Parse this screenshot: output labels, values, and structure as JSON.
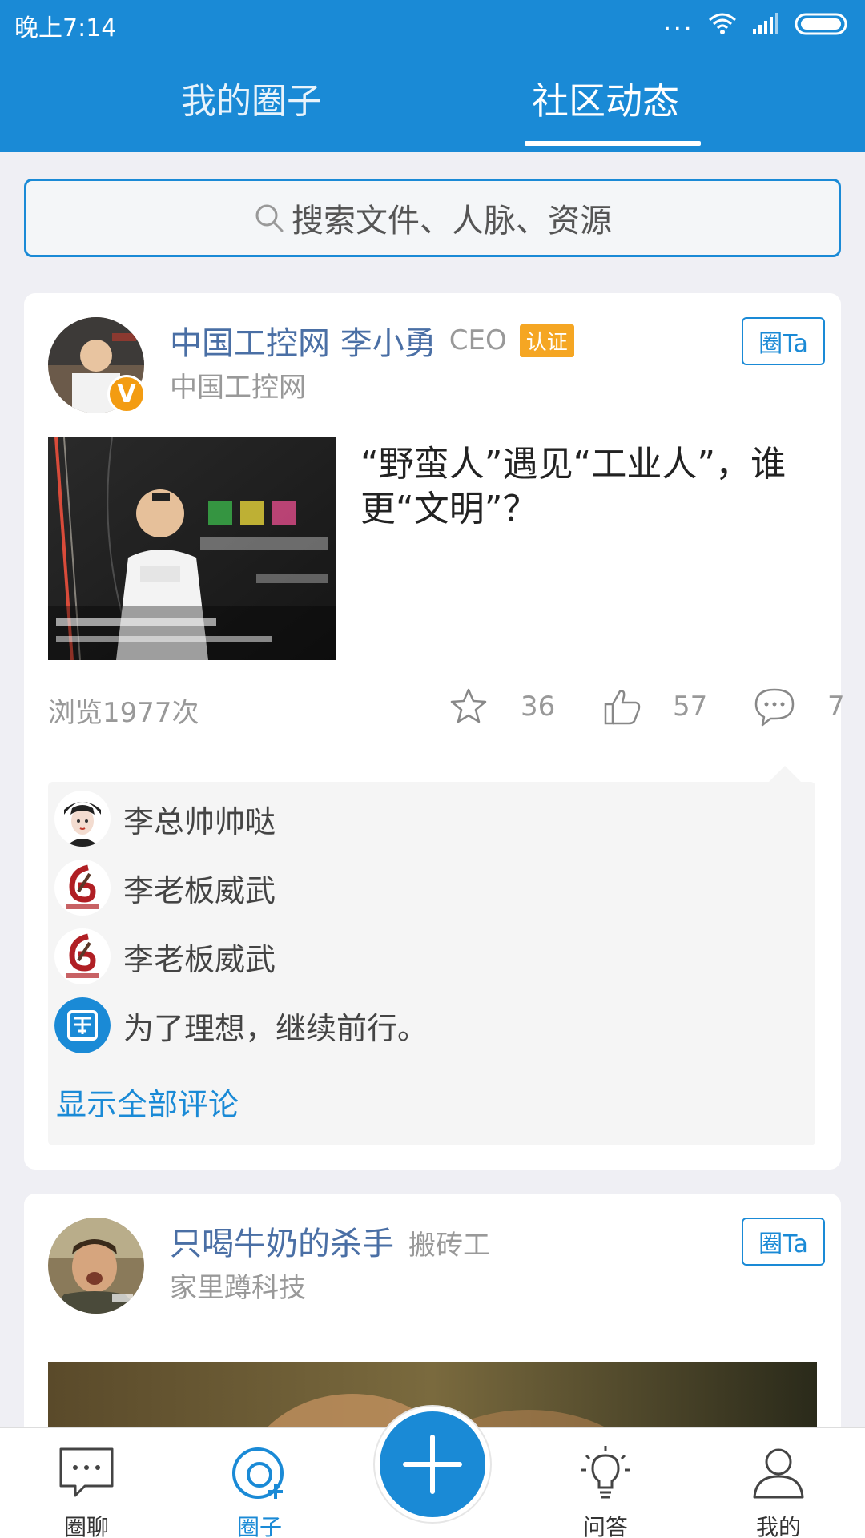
{
  "status_bar": {
    "time": "晚上7:14",
    "dots": "..."
  },
  "tabs": {
    "my_circles": "我的圈子",
    "community": "社区动态"
  },
  "search": {
    "placeholder": "搜索文件、人脉、资源"
  },
  "post1": {
    "author": "中国工控网 李小勇",
    "title": "CEO",
    "badge": "认证",
    "company": "中国工控网",
    "follow": "圈Ta",
    "vip": "V",
    "headline": "“野蛮人”遇见“工业人”，谁更“文明”？",
    "views": "浏览1977次",
    "stars": "36",
    "likes": "57",
    "comments_count": "7",
    "comments": [
      {
        "text": "李总帅帅哒"
      },
      {
        "text": "李老板威武"
      },
      {
        "text": "李老板威武"
      },
      {
        "text": "为了理想，继续前行。"
      }
    ],
    "show_all": "显示全部评论"
  },
  "post2": {
    "author": "只喝牛奶的杀手",
    "title": "搬砖工",
    "company": "家里蹲科技",
    "follow": "圈Ta"
  },
  "nav": {
    "chat": "圈聊",
    "circle": "圈子",
    "qa": "问答",
    "me": "我的"
  },
  "colors": {
    "primary": "#1a8ad6",
    "badge": "#f5a623",
    "name": "#4a6fa5"
  }
}
